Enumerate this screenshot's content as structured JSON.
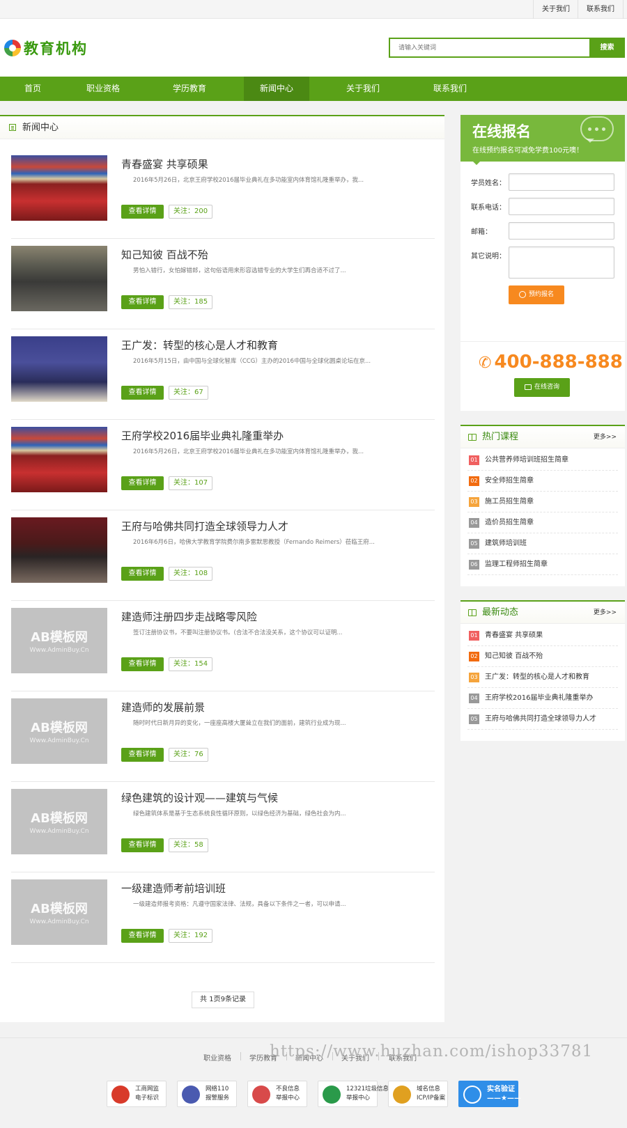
{
  "topbar": {
    "about": "关于我们",
    "contact": "联系我们"
  },
  "header": {
    "logo_text": "教育机构",
    "search_placeholder": "请输入关键词",
    "search_button": "搜索"
  },
  "nav": [
    {
      "label": "首页"
    },
    {
      "label": "职业资格"
    },
    {
      "label": "学历教育"
    },
    {
      "label": "新闻中心",
      "active": true
    },
    {
      "label": "关于我们"
    },
    {
      "label": "联系我们"
    }
  ],
  "main": {
    "heading": "新闻中心",
    "detail_label": "查看详情",
    "articles": [
      {
        "title": "青春盛宴 共享硕果",
        "desc": "2016年5月26日，北京王府学校2016届毕业典礼在多功能室内体育馆礼隆重举办，我...",
        "follow": "关注：200",
        "image": "graduation-ceremony"
      },
      {
        "title": "知己知彼 百战不殆",
        "desc": "男怕入错行，女怕嫁错郎，这句俗语用来形容选错专业的大学生们再合适不过了...",
        "follow": "关注：185",
        "image": "lecture-hall"
      },
      {
        "title": "王广发：转型的核心是人才和教育",
        "desc": "2016年5月15日，由中国与全球化智库（CCG）主办的2016中国与全球化圆桌论坛在京...",
        "follow": "关注：67",
        "image": "forum-speaker"
      },
      {
        "title": "王府学校2016届毕业典礼隆重举办",
        "desc": "2016年5月26日，北京王府学校2016届毕业典礼在多功能室内体育馆礼隆重举办，我...",
        "follow": "关注：107",
        "image": "graduation-ceremony"
      },
      {
        "title": "王府与哈佛共同打造全球领导力人才",
        "desc": "2016年6月6日，哈佛大学教育学院费尔南多雷默思教授（Fernando Reimers）莅临王府...",
        "follow": "关注：108",
        "image": "panel-meeting"
      },
      {
        "title": "建造师注册四步走战略零风险",
        "desc": "签订注册协议书，不要叫注册协议书。(合法不合法没关系，这个协议可以证明...",
        "follow": "关注：154",
        "image": "placeholder"
      },
      {
        "title": "建造师的发展前景",
        "desc": "随时时代日新月异的变化，一座座高楼大厦耸立在我们的面前，建筑行业成为现...",
        "follow": "关注：76",
        "image": "placeholder"
      },
      {
        "title": "绿色建筑的设计观——建筑与气候",
        "desc": "绿色建筑体系是基于生态系统良性循环原则，以绿色经济为基础，绿色社会为内...",
        "follow": "关注：58",
        "image": "placeholder"
      },
      {
        "title": "一级建造师考前培训班",
        "desc": "一级建造师报考资格：凡遵守国家法律、法规，具备以下条件之一者，可以申请...",
        "follow": "关注：192",
        "image": "placeholder"
      }
    ],
    "placeholder_line1": "AB模板网",
    "placeholder_line2": "Www.AdminBuy.Cn",
    "pager": "共 1页9条记录"
  },
  "registration": {
    "title": "在线报名",
    "subtitle": "在线预约报名可减免学费100元噢！",
    "fields": {
      "name": "学员姓名：",
      "phone": "联系电话：",
      "email": "邮箱：",
      "note": "其它说明："
    },
    "submit": "预约报名",
    "hotline": "400-888-888",
    "consult": "在线咨询"
  },
  "hot_courses": {
    "title": "热门课程",
    "more": "更多>>",
    "items": [
      {
        "num": "01",
        "label": "公共营养师培训班招生简章"
      },
      {
        "num": "02",
        "label": "安全师招生简章"
      },
      {
        "num": "03",
        "label": "施工员招生简章"
      },
      {
        "num": "04",
        "label": "造价员招生简章"
      },
      {
        "num": "05",
        "label": "建筑师培训班"
      },
      {
        "num": "06",
        "label": "监理工程师招生简章"
      }
    ]
  },
  "latest_news": {
    "title": "最新动态",
    "more": "更多>>",
    "items": [
      {
        "num": "01",
        "label": "青春盛宴 共享硕果"
      },
      {
        "num": "02",
        "label": "知己知彼 百战不殆"
      },
      {
        "num": "03",
        "label": "王广发：转型的核心是人才和教育"
      },
      {
        "num": "04",
        "label": "王府学校2016届毕业典礼隆重举办"
      },
      {
        "num": "05",
        "label": "王府与哈佛共同打造全球领导力人才"
      }
    ]
  },
  "footer": {
    "links": [
      "职业资格",
      "学历教育",
      "新闻中心",
      "关于我们",
      "联系我们"
    ],
    "watermark": "https://www.huzhan.com/ishop33781",
    "badges": [
      {
        "line1": "工商网监",
        "line2": "电子标识"
      },
      {
        "line1": "网络110",
        "line2": "报警服务"
      },
      {
        "line1": "不良信息",
        "line2": "举报中心"
      },
      {
        "line1": "12321垃圾信息",
        "line2": "举报中心"
      },
      {
        "line1": "域名信息",
        "line2": "ICP/IP备案"
      },
      {
        "line1": "实名验证",
        "line2": "——★——"
      }
    ]
  },
  "colors": {
    "brand_green": "#5aa118",
    "accent_orange": "#f7891f",
    "num_colors": [
      "#f06060",
      "#f26b0f",
      "#f5a43c",
      "#999999",
      "#999999",
      "#999999"
    ]
  }
}
